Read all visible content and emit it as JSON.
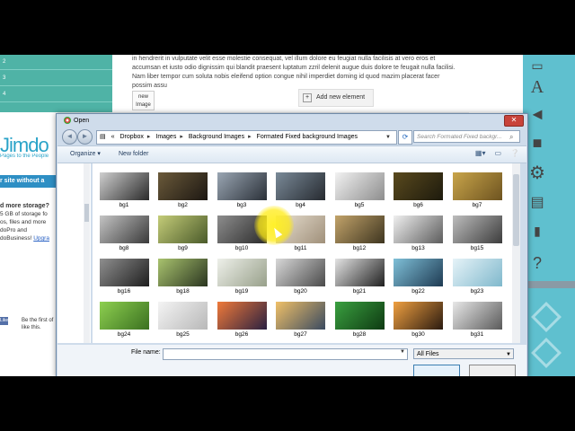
{
  "background_page": {
    "nav_items": [
      "2",
      "3",
      "4"
    ],
    "logo": "Jimdo",
    "tagline": "Pages to the People",
    "site_banner": "r site without a",
    "storage_title": "d more storage?",
    "storage_lines": [
      "5 GB of storage fo",
      "os, files and more",
      "doPro and",
      "doBusiness!"
    ],
    "storage_link": "Upgra",
    "like_button": "Like",
    "like_text": "Be the first of like this.",
    "lorem": "in hendrerit in vulputate velit esse molestie consequat, vel illum dolore eu feugiat nulla facilisis at vero eros et accumsan et iusto odio dignissim qui blandit praesent luptatum zzril delenit augue duis dolore te feugait nulla facilisi. Nam liber tempor cum soluta nobis eleifend option congue nihil imperdiet doming id quod mazim placerat facer possim assu",
    "new_image_label": "new Image",
    "add_element_label": "Add new element"
  },
  "dialog": {
    "title": "Open",
    "breadcrumb": [
      "«",
      "Dropbox",
      "Images",
      "Background Images",
      "Formated Fixed background Images"
    ],
    "search_placeholder": "Search Formated Fixed backgr...",
    "organize_label": "Organize ▾",
    "new_folder_label": "New folder",
    "file_name_label": "File name:",
    "file_name_value": "",
    "file_type": "All Files",
    "files": [
      {
        "name": "bg1",
        "c1": "#cfcfcf",
        "c2": "#2a2a2a"
      },
      {
        "name": "bg2",
        "c1": "#6b5a3a",
        "c2": "#1c1712"
      },
      {
        "name": "bg3",
        "c1": "#9aa6b3",
        "c2": "#2a3038"
      },
      {
        "name": "bg4",
        "c1": "#7a8a98",
        "c2": "#262a30"
      },
      {
        "name": "bg5",
        "c1": "#f2f2f2",
        "c2": "#8d8d8d"
      },
      {
        "name": "bg6",
        "c1": "#5a4a1e",
        "c2": "#1d1a0d"
      },
      {
        "name": "bg7",
        "c1": "#c9a54a",
        "c2": "#6d5320"
      },
      {
        "name": "bg8",
        "c1": "#c4c4c4",
        "c2": "#3a3a3a"
      },
      {
        "name": "bg9",
        "c1": "#c4cc78",
        "c2": "#4a5a2a"
      },
      {
        "name": "bg10",
        "c1": "#8d8d8d",
        "c2": "#2b2b2b"
      },
      {
        "name": "bg11",
        "c1": "#e8e0d2",
        "c2": "#a0907a"
      },
      {
        "name": "bg12",
        "c1": "#c2a36a",
        "c2": "#3e3520"
      },
      {
        "name": "bg13",
        "c1": "#f0f0f0",
        "c2": "#5c5c5c"
      },
      {
        "name": "bg15",
        "c1": "#bdbdbd",
        "c2": "#3c3c3c"
      },
      {
        "name": "bg16",
        "c1": "#8f8f8f",
        "c2": "#1e1e1e"
      },
      {
        "name": "bg18",
        "c1": "#a9c36e",
        "c2": "#2a3520"
      },
      {
        "name": "bg19",
        "c1": "#eef0ea",
        "c2": "#98a08a"
      },
      {
        "name": "bg20",
        "c1": "#d8d8d8",
        "c2": "#4a4a4a"
      },
      {
        "name": "bg21",
        "c1": "#e4e4e4",
        "c2": "#202020"
      },
      {
        "name": "bg22",
        "c1": "#7fc0d8",
        "c2": "#1e3a52"
      },
      {
        "name": "bg23",
        "c1": "#e6f3f8",
        "c2": "#7fb8cc"
      },
      {
        "name": "bg24",
        "c1": "#8ed050",
        "c2": "#3a7020"
      },
      {
        "name": "bg25",
        "c1": "#f4f4f4",
        "c2": "#b8b8b8"
      },
      {
        "name": "bg26",
        "c1": "#f07a3a",
        "c2": "#2a2040"
      },
      {
        "name": "bg27",
        "c1": "#f0c068",
        "c2": "#3a4a60"
      },
      {
        "name": "bg28",
        "c1": "#3aa040",
        "c2": "#0e3a12"
      },
      {
        "name": "bg30",
        "c1": "#f0a040",
        "c2": "#2a1a10"
      },
      {
        "name": "bg31",
        "c1": "#e8e8e8",
        "c2": "#5a5a5a"
      }
    ],
    "partial_row_colors": [
      "#dcdcdc",
      "#e8e8e8",
      "#ffffff",
      "#c9c9c9",
      "#b8b8b8",
      "#3a2a1a",
      "#2a4a5a",
      "#1e1e1e"
    ]
  }
}
